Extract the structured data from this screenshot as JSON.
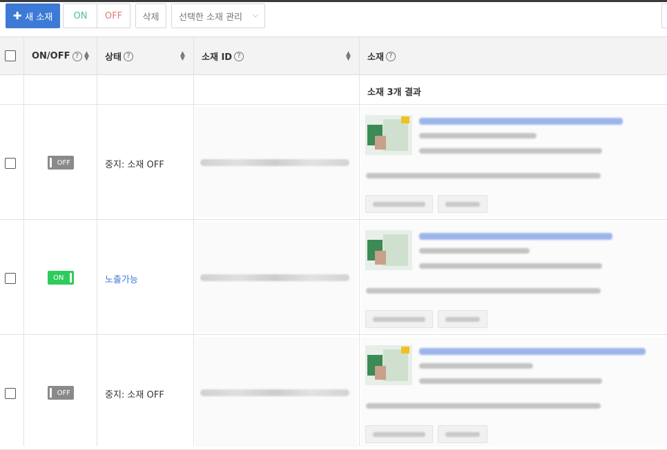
{
  "toolbar": {
    "new_label": "새 소재",
    "on_label": "ON",
    "off_label": "OFF",
    "delete_label": "삭제",
    "manage_label": "선택한 소재 관리"
  },
  "table": {
    "headers": {
      "onoff": "ON/OFF",
      "status": "상태",
      "creative_id": "소재 ID",
      "creative": "소재"
    },
    "result_text": "소재 3개 결과",
    "rows": [
      {
        "toggle": "OFF",
        "status": "중지: 소재 OFF"
      },
      {
        "toggle": "ON",
        "status": "노출가능"
      },
      {
        "toggle": "OFF",
        "status": "중지: 소재 OFF"
      }
    ]
  },
  "icons": {
    "plus": "plus-icon",
    "help": "question-circle-icon",
    "sort": "sort-icon",
    "chevron": "chevron-down-icon"
  },
  "colors": {
    "primary": "#3d7ad6",
    "on_green": "#2ecc5b",
    "off_gray": "#8a8a8a"
  }
}
